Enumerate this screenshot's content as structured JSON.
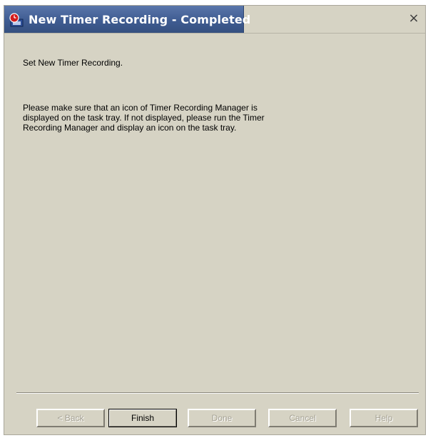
{
  "window": {
    "title": "New Timer Recording - Completed",
    "icon": "timer-recording-app-icon",
    "close_glyph": "×"
  },
  "content": {
    "heading": "Set New Timer Recording.",
    "message": "Please make sure that an icon of Timer Recording Manager is displayed on the task tray. If not displayed, please run the Timer Recording Manager and display an icon on the task tray."
  },
  "buttons": {
    "back": {
      "label": "< Back",
      "enabled": false
    },
    "finish": {
      "label": "Finish",
      "enabled": true
    },
    "done": {
      "label": "Done",
      "enabled": false
    },
    "cancel": {
      "label": "Cancel",
      "enabled": false
    },
    "help": {
      "label": "Help",
      "enabled": false
    }
  },
  "colors": {
    "title_bar": "#3f5c92",
    "dialog_face": "#d6d3c4",
    "disabled_text": "#a5a294"
  }
}
